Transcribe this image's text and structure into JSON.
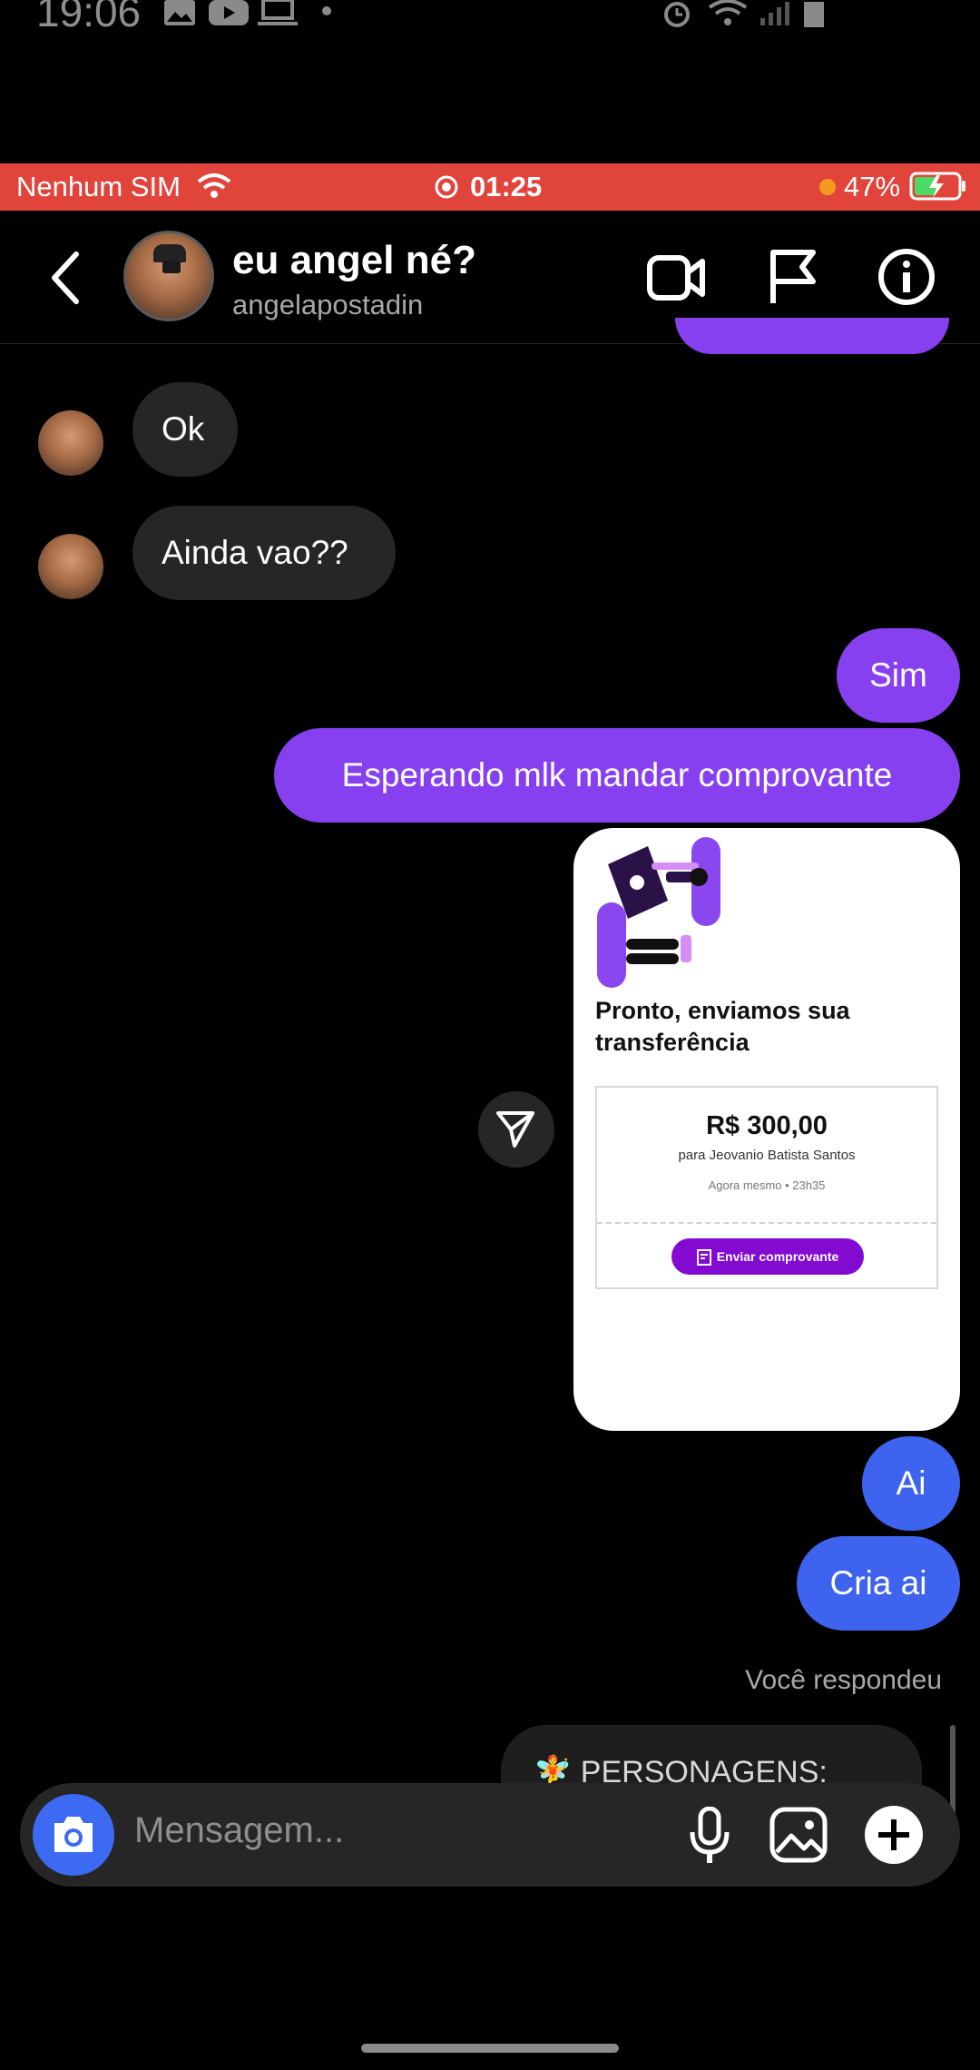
{
  "android_status": {
    "time": "19:06"
  },
  "ios_status": {
    "carrier": "Nenhum SIM",
    "time": "01:25",
    "battery": "47%"
  },
  "header": {
    "title": "eu angel né?",
    "username": "angelapostadin"
  },
  "messages": {
    "incoming": [
      {
        "text": "Ok"
      },
      {
        "text": "Ainda vao??"
      }
    ],
    "outgoing": [
      {
        "text": "Sim"
      },
      {
        "text": "Esperando mlk mandar comprovante"
      },
      {
        "text": "Ai"
      },
      {
        "text": "Cria ai"
      }
    ]
  },
  "receipt_card": {
    "title": "Pronto, enviamos sua transferência",
    "amount": "R$ 300,00",
    "recipient": "para Jeovanio Batista Santos",
    "when": "Agora mesmo • 23h35",
    "button_label": "Enviar comprovante"
  },
  "reply_label": "Você respondeu",
  "reply_preview": "🧚 PERSONAGENS:",
  "composer": {
    "placeholder": "Mensagem..."
  },
  "colors": {
    "outgoing_purple": "#8640f0",
    "outgoing_blue": "#3d63ef",
    "incoming": "#262626",
    "ios_bar": "#e0443a",
    "nubank_purple": "#820ad1"
  }
}
